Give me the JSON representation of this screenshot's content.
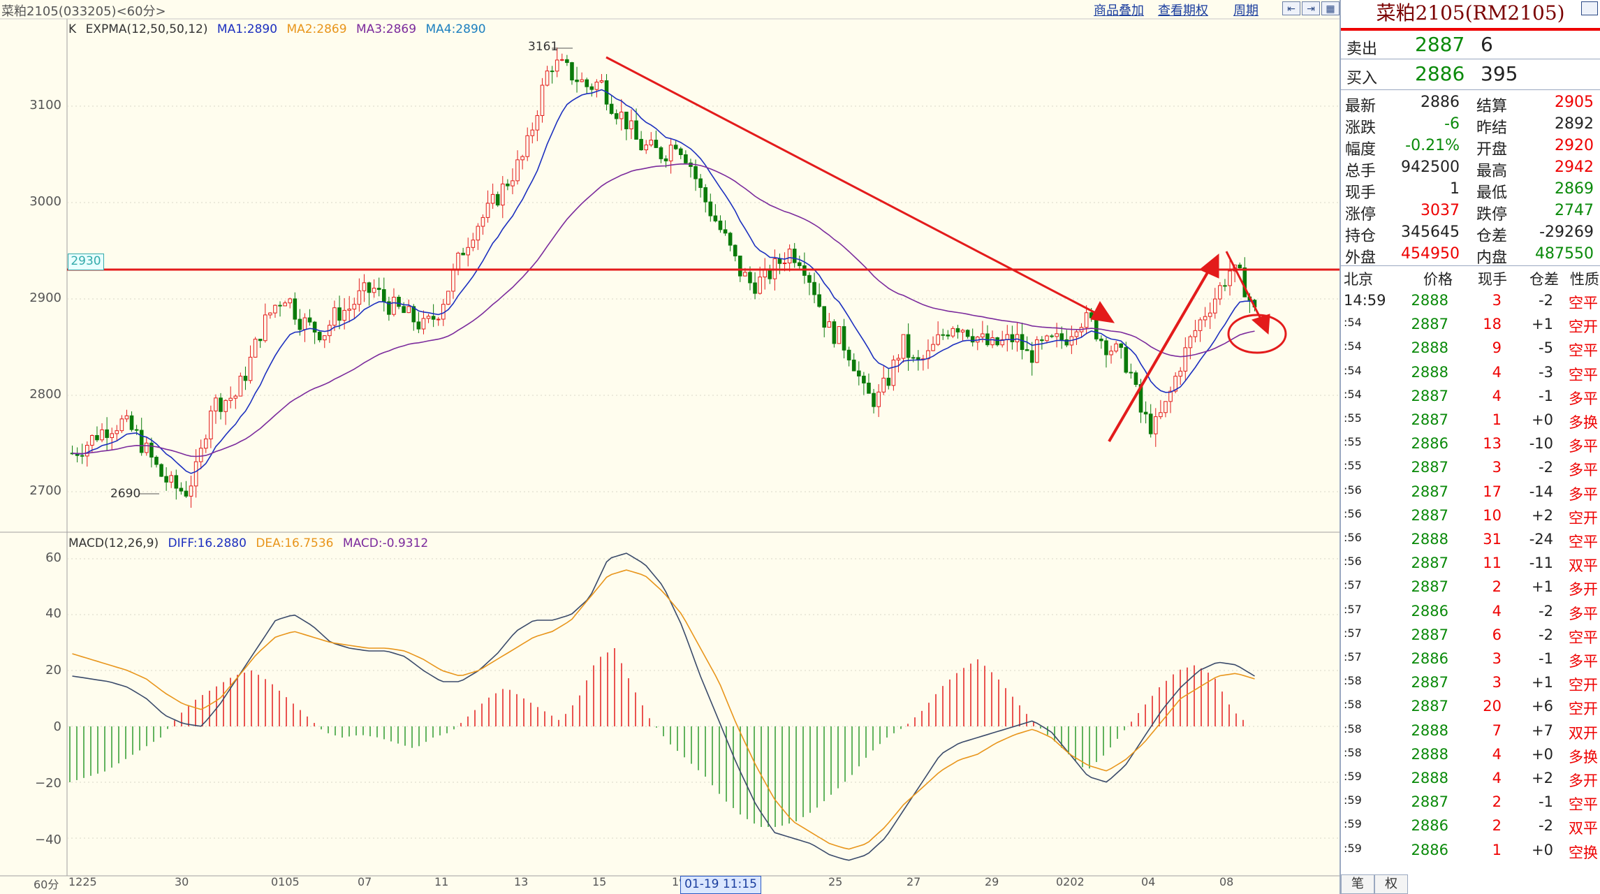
{
  "window": {
    "title": "菜粕2105(033205)<60分>",
    "links": [
      "商品叠加",
      "查看期权",
      "周期"
    ]
  },
  "main_chart": {
    "indicator_prefix": "K",
    "indicator_name": "EXPMA(12,50,50,12)",
    "ma1": "MA1:2890",
    "ma2": "MA2:2869",
    "ma3": "MA3:2869",
    "ma4": "MA4:2890",
    "price_marker": "2930",
    "high_label": "3161",
    "low_label": "2690",
    "y_ticks": [
      "3100",
      "3000",
      "2900",
      "2800",
      "2700"
    ],
    "colors": {
      "ma1": "#1c2fbf",
      "ma2": "#e8951b",
      "ma3": "#7b2a9c",
      "ma4": "#1c7fbf",
      "resistance": "#e31b1b"
    }
  },
  "macd_chart": {
    "indicator_name": "MACD(12,26,9)",
    "diff": "DIFF:16.2880",
    "dea": "DEA:16.7536",
    "macd": "MACD:-0.9312",
    "y_ticks": [
      "60",
      "40",
      "20",
      "0",
      "−20",
      "−40"
    ]
  },
  "x_axis": {
    "period_label": "60分",
    "labels": [
      "1225",
      "30",
      "0105",
      "07",
      "11",
      "13",
      "15",
      "19",
      "25",
      "27",
      "29",
      "0202",
      "04",
      "08"
    ],
    "cursor_label": "01-19 11:15"
  },
  "chart_data": {
    "type": "candlestick",
    "title": "菜粕2105(033205)<60分>",
    "ylim": [
      2680,
      3180
    ],
    "y_ticks": [
      2700,
      2800,
      2900,
      3000,
      3100
    ],
    "resistance_level": 2930,
    "high": 3161,
    "low": 2690,
    "close_trend": [
      2740,
      2748,
      2760,
      2768,
      2772,
      2760,
      2740,
      2718,
      2705,
      2700,
      2725,
      2790,
      2795,
      2800,
      2830,
      2868,
      2892,
      2905,
      2880,
      2870,
      2865,
      2885,
      2890,
      2905,
      2910,
      2895,
      2888,
      2880,
      2870,
      2885,
      2915,
      2950,
      2975,
      2990,
      3010,
      3030,
      3050,
      3100,
      3145,
      3140,
      3130,
      3120,
      3125,
      3100,
      3085,
      3060,
      3055,
      3050,
      3065,
      3045,
      3010,
      2985,
      2960,
      2930,
      2915,
      2920,
      2935,
      2950,
      2942,
      2910,
      2870,
      2860,
      2840,
      2800,
      2795,
      2820,
      2855,
      2830,
      2840,
      2860,
      2875,
      2870,
      2860,
      2850,
      2855,
      2860,
      2840,
      2850,
      2855,
      2860,
      2880,
      2875,
      2855,
      2845,
      2830,
      2780,
      2765,
      2790,
      2830,
      2860,
      2885,
      2905,
      2930,
      2920,
      2886
    ],
    "macd": {
      "diff_trend": [
        18,
        17,
        16,
        14,
        10,
        4,
        1,
        0,
        8,
        18,
        28,
        38,
        40,
        36,
        30,
        28,
        27,
        27,
        25,
        20,
        16,
        16,
        20,
        26,
        34,
        38,
        38,
        40,
        46,
        60,
        62,
        58,
        50,
        36,
        18,
        2,
        -14,
        -28,
        -38,
        -40,
        -42,
        -46,
        -48,
        -46,
        -40,
        -30,
        -20,
        -10,
        -6,
        -4,
        -2,
        0,
        2,
        -2,
        -10,
        -18,
        -20,
        -14,
        -4,
        6,
        14,
        20,
        23,
        22,
        18
      ],
      "dea_trend": [
        26,
        24,
        22,
        20,
        17,
        12,
        8,
        6,
        10,
        18,
        26,
        32,
        34,
        32,
        30,
        29,
        28,
        28,
        27,
        24,
        20,
        18,
        20,
        24,
        28,
        32,
        34,
        38,
        46,
        54,
        56,
        54,
        48,
        40,
        28,
        16,
        0,
        -14,
        -26,
        -34,
        -38,
        -42,
        -44,
        -42,
        -36,
        -28,
        -22,
        -16,
        -12,
        -10,
        -6,
        -3,
        -1,
        -4,
        -10,
        -14,
        -16,
        -12,
        -6,
        2,
        10,
        14,
        18,
        19,
        17
      ],
      "hist_trend": [
        -20,
        -18,
        -16,
        -12,
        -8,
        -4,
        4,
        10,
        14,
        18,
        20,
        16,
        10,
        4,
        -2,
        -4,
        -3,
        -4,
        -6,
        -8,
        -4,
        -2,
        4,
        10,
        14,
        10,
        6,
        2,
        10,
        24,
        28,
        14,
        2,
        -6,
        -12,
        -18,
        -26,
        -32,
        -36,
        -36,
        -34,
        -30,
        -24,
        -18,
        -10,
        -4,
        0,
        6,
        14,
        20,
        24,
        18,
        10,
        2,
        -4,
        -10,
        -16,
        -10,
        -2,
        6,
        14,
        20,
        22,
        18,
        6,
        0
      ]
    }
  },
  "panel": {
    "symbol": "菜粕2105(RM2105)",
    "sell_label": "卖出",
    "sell_price": "2887",
    "sell_vol": "6",
    "buy_label": "买入",
    "buy_price": "2886",
    "buy_vol": "395",
    "stats": [
      {
        "l1": "最新",
        "v1": "2886",
        "c1": "#222",
        "l2": "结算",
        "v2": "2905",
        "c2": "#e00"
      },
      {
        "l1": "涨跌",
        "v1": "-6",
        "c1": "#0a8a0a",
        "l2": "昨结",
        "v2": "2892",
        "c2": "#222"
      },
      {
        "l1": "幅度",
        "v1": "-0.21%",
        "c1": "#0a8a0a",
        "l2": "开盘",
        "v2": "2920",
        "c2": "#e00"
      },
      {
        "l1": "总手",
        "v1": "942500",
        "c1": "#222",
        "l2": "最高",
        "v2": "2942",
        "c2": "#e00"
      },
      {
        "l1": "现手",
        "v1": "1",
        "c1": "#222",
        "l2": "最低",
        "v2": "2869",
        "c2": "#0a8a0a"
      },
      {
        "l1": "涨停",
        "v1": "3037",
        "c1": "#e00",
        "l2": "跌停",
        "v2": "2747",
        "c2": "#0a8a0a"
      },
      {
        "l1": "持仓",
        "v1": "345645",
        "c1": "#222",
        "l2": "仓差",
        "v2": "-29269",
        "c2": "#222"
      },
      {
        "l1": "外盘",
        "v1": "454950",
        "c1": "#e00",
        "l2": "内盘",
        "v2": "487550",
        "c2": "#0a8a0a"
      }
    ],
    "ticks_header": {
      "time": "北京",
      "price": "价格",
      "vol": "现手",
      "oi": "仓差",
      "nature": "性质"
    },
    "ticks": [
      {
        "t": "14:59",
        "p": "2888",
        "v": "3",
        "o": "-2",
        "n": "空平"
      },
      {
        "t": ":54",
        "p": "2887",
        "v": "18",
        "o": "+1",
        "n": "空开"
      },
      {
        "t": ":54",
        "p": "2888",
        "v": "9",
        "o": "-5",
        "n": "空平"
      },
      {
        "t": ":54",
        "p": "2888",
        "v": "4",
        "o": "-3",
        "n": "空平"
      },
      {
        "t": ":54",
        "p": "2887",
        "v": "4",
        "o": "-1",
        "n": "多平"
      },
      {
        "t": ":55",
        "p": "2887",
        "v": "1",
        "o": "+0",
        "n": "多换"
      },
      {
        "t": ":55",
        "p": "2886",
        "v": "13",
        "o": "-10",
        "n": "多平"
      },
      {
        "t": ":55",
        "p": "2887",
        "v": "3",
        "o": "-2",
        "n": "多平"
      },
      {
        "t": ":56",
        "p": "2887",
        "v": "17",
        "o": "-14",
        "n": "多平"
      },
      {
        "t": ":56",
        "p": "2887",
        "v": "10",
        "o": "+2",
        "n": "空开"
      },
      {
        "t": ":56",
        "p": "2888",
        "v": "31",
        "o": "-24",
        "n": "空平"
      },
      {
        "t": ":56",
        "p": "2887",
        "v": "11",
        "o": "-11",
        "n": "双平"
      },
      {
        "t": ":57",
        "p": "2887",
        "v": "2",
        "o": "+1",
        "n": "多开"
      },
      {
        "t": ":57",
        "p": "2886",
        "v": "4",
        "o": "-2",
        "n": "多平"
      },
      {
        "t": ":57",
        "p": "2887",
        "v": "6",
        "o": "-2",
        "n": "空平"
      },
      {
        "t": ":57",
        "p": "2886",
        "v": "3",
        "o": "-1",
        "n": "多平"
      },
      {
        "t": ":58",
        "p": "2887",
        "v": "3",
        "o": "+1",
        "n": "空开"
      },
      {
        "t": ":58",
        "p": "2887",
        "v": "20",
        "o": "+6",
        "n": "空开"
      },
      {
        "t": ":58",
        "p": "2888",
        "v": "7",
        "o": "+7",
        "n": "双开"
      },
      {
        "t": ":58",
        "p": "2888",
        "v": "4",
        "o": "+0",
        "n": "多换"
      },
      {
        "t": ":59",
        "p": "2888",
        "v": "4",
        "o": "+2",
        "n": "多开"
      },
      {
        "t": ":59",
        "p": "2887",
        "v": "2",
        "o": "-1",
        "n": "空平"
      },
      {
        "t": ":59",
        "p": "2886",
        "v": "2",
        "o": "-2",
        "n": "双平"
      },
      {
        "t": ":59",
        "p": "2886",
        "v": "1",
        "o": "+0",
        "n": "空换"
      }
    ],
    "tabs": [
      "笔",
      "权"
    ]
  }
}
